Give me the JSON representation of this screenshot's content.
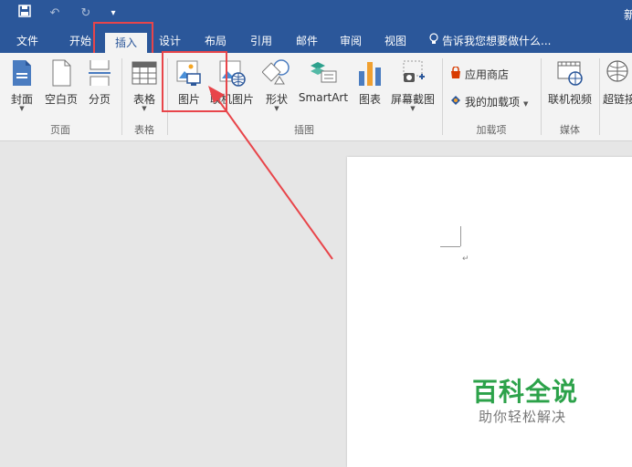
{
  "titlebar": {
    "title_fragment": "新",
    "undo_label": "↶",
    "redo_label": "↻",
    "customize_label": "▾"
  },
  "tabs": [
    {
      "label": "文件"
    },
    {
      "label": "开始"
    },
    {
      "label": "插入"
    },
    {
      "label": "设计"
    },
    {
      "label": "布局"
    },
    {
      "label": "引用"
    },
    {
      "label": "邮件"
    },
    {
      "label": "审阅"
    },
    {
      "label": "视图"
    }
  ],
  "tell_me": {
    "text": "告诉我您想要做什么..."
  },
  "ribbon": {
    "pages": {
      "cover": "封面",
      "blank": "空白页",
      "break": "分页",
      "group": "页面"
    },
    "tables": {
      "table": "表格",
      "group": "表格"
    },
    "illustrations": {
      "pictures": "图片",
      "online_pictures": "联机图片",
      "shapes": "形状",
      "smartart": "SmartArt",
      "chart": "图表",
      "screenshot": "屏幕截图",
      "group": "插图"
    },
    "addins": {
      "store": "应用商店",
      "my_addins": "我的加载项",
      "group": "加载项"
    },
    "media": {
      "online_video": "联机视频",
      "group": "媒体"
    },
    "links": {
      "hyperlink": "超链接"
    }
  },
  "document": {
    "paragraph_mark": "↵"
  },
  "watermark": {
    "title": "百科全说",
    "subtitle": "助你轻松解决"
  },
  "colors": {
    "accent": "#2b579a",
    "highlight": "#e8454a",
    "watermark": "#2ca24a"
  }
}
